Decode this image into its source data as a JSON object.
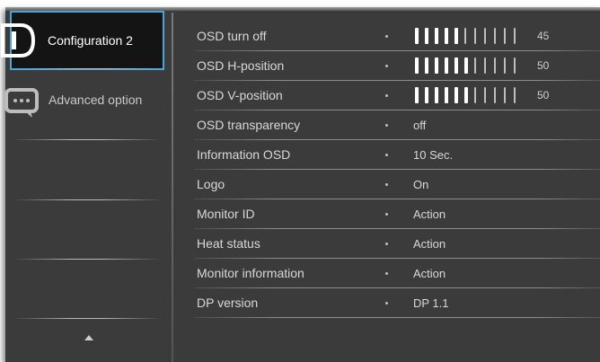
{
  "sidebar": {
    "items": [
      {
        "label": "Configuration 2",
        "icon": "display-port-icon",
        "selected": true
      },
      {
        "label": "Advanced option",
        "icon": "speech-bubble-icon",
        "selected": false
      }
    ]
  },
  "settings": {
    "rows": [
      {
        "name": "OSD turn off",
        "level": 45,
        "level_text": "45"
      },
      {
        "name": "OSD H-position",
        "level": 50,
        "level_text": "50"
      },
      {
        "name": "OSD V-position",
        "level": 50,
        "level_text": "50"
      },
      {
        "name": "OSD transparency",
        "value": "off"
      },
      {
        "name": "Information OSD",
        "value": "10 Sec."
      },
      {
        "name": "Logo",
        "value": "On"
      },
      {
        "name": "Monitor ID",
        "value": "Action"
      },
      {
        "name": "Heat status",
        "value": "Action"
      },
      {
        "name": "Monitor information",
        "value": "Action"
      },
      {
        "name": "DP version",
        "value": "DP 1.1"
      }
    ]
  },
  "colors": {
    "panel": "#3b3b3b",
    "selection_border": "#4aa5d8",
    "selected_bg": "#141414"
  }
}
